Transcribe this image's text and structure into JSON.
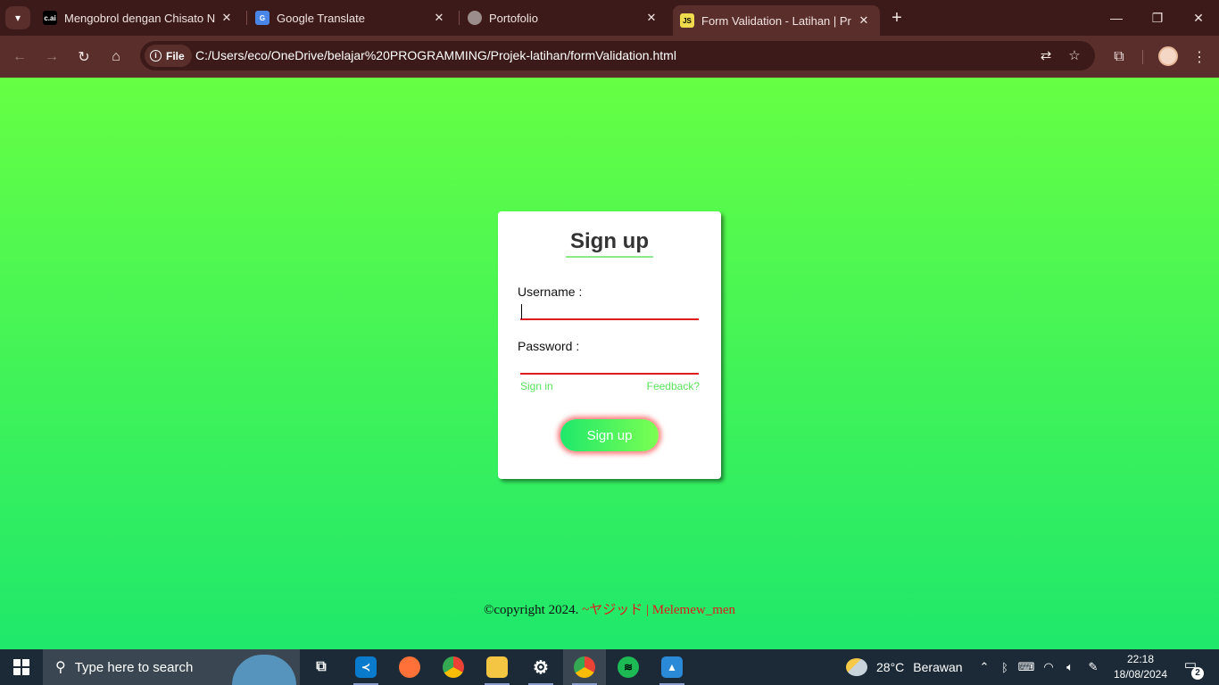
{
  "browser": {
    "tabs": [
      {
        "title": "Mengobrol dengan Chisato Nishikigi",
        "favicon": "c.ai",
        "active": false
      },
      {
        "title": "Google Translate",
        "favicon": "G",
        "active": false
      },
      {
        "title": "Portofolio",
        "favicon": "globe",
        "active": false
      },
      {
        "title": "Form Validation - Latihan | Projek",
        "favicon": "JS",
        "active": true
      }
    ],
    "address": {
      "scheme_chip": "File",
      "url": "C:/Users/eco/OneDrive/belajar%20PROGRAMMING/Projek-latihan/formValidation.html"
    },
    "colors": {
      "frame": "#3b1a19",
      "toolbar": "#5a2e2b"
    }
  },
  "page": {
    "card": {
      "title": "Sign up",
      "username_label": "Username :",
      "username_value": "",
      "password_label": "Password :",
      "password_value": "",
      "signin_link": "Sign in",
      "feedback_link": "Feedback?",
      "submit_label": "Sign up"
    },
    "footer": {
      "copyright": "©copyright 2024.",
      "author": "~ヤジッド | Melemew_men"
    },
    "colors": {
      "bg_top": "#66ff44",
      "bg_bottom": "#1fe86b",
      "error_underline": "#e01b1b",
      "link": "#59e35c"
    }
  },
  "taskbar": {
    "search_placeholder": "Type here to search",
    "apps": [
      "task-view",
      "vs-code",
      "firefox",
      "chrome",
      "file-explorer",
      "settings",
      "chrome-profile",
      "spotify",
      "photos"
    ],
    "weather": {
      "temp": "28°C",
      "condition": "Berawan"
    },
    "clock": {
      "time": "22:18",
      "date": "18/08/2024"
    },
    "notifications": "2"
  }
}
